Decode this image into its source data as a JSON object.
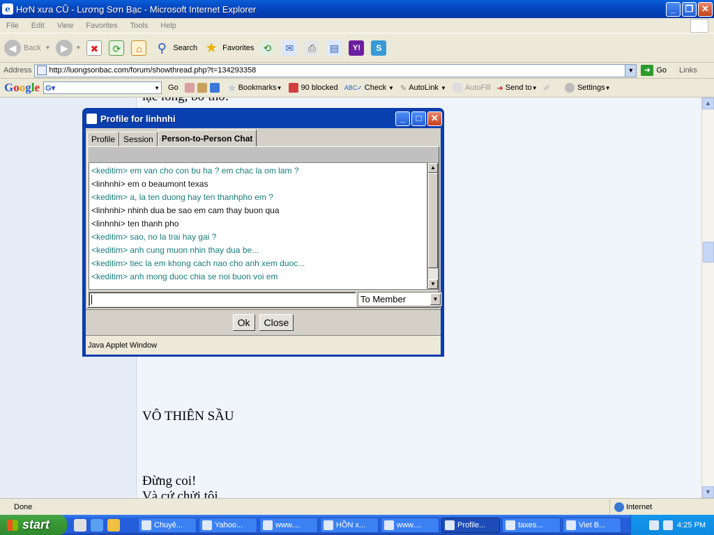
{
  "window": {
    "title": "HơN xưa CŨ - Lương Sơn Bạc - Microsoft Internet Explorer"
  },
  "menu": [
    "File",
    "Edit",
    "View",
    "Favorites",
    "Tools",
    "Help"
  ],
  "toolbar": {
    "back": "Back",
    "search": "Search",
    "favorites": "Favorites"
  },
  "address": {
    "label": "Address",
    "url": "http://luongsonbac.com/forum/showthread.php?t=134293358",
    "go": "Go",
    "links": "Links"
  },
  "googlebar": {
    "logo": "Google",
    "go": "Go",
    "bookmarks": "Bookmarks",
    "blocked": "90 blocked",
    "check": "Check",
    "autolink": "AutoLink",
    "autofill": "AutoFill",
    "sendto": "Send to",
    "settings": "Settings"
  },
  "page": {
    "top_text": "lạc lõng, bơ thờ.",
    "heading": "VÔ THIÊN SẦU",
    "line1": "Đừng coi!",
    "line2": "Và cứ chửi tôi,"
  },
  "dialog": {
    "title": "Profile for linhnhi",
    "tabs": [
      "Profile",
      "Session",
      "Person-to-Person Chat"
    ],
    "messages": [
      {
        "text": "<keditim> em van cho con bu ha ? em chac la om lam ?",
        "sender": "keditim"
      },
      {
        "text": "<linhnhi>  em o beaumont texas",
        "sender": "linhnhi"
      },
      {
        "text": "<keditim> a, la ten duong hay ten thanhpho em ?",
        "sender": "keditim"
      },
      {
        "text": "<linhnhi>  nhinh dua be sao em cam thay buon qua",
        "sender": "linhnhi"
      },
      {
        "text": "<linhnhi>  ten thanh pho",
        "sender": "linhnhi"
      },
      {
        "text": "<keditim> sao, no la trai hay gai ?",
        "sender": "keditim"
      },
      {
        "text": "<keditim> anh cung muon nhin thay dua be...",
        "sender": "keditim"
      },
      {
        "text": "<keditim> tiec la em khong cach nao cho anh xem duoc...",
        "sender": "keditim"
      },
      {
        "text": "<keditim> anh mong duoc chia se noi buon voi em",
        "sender": "keditim"
      }
    ],
    "input_value": "",
    "recipient": "To Member",
    "ok": "Ok",
    "close": "Close",
    "applet_label": "Java Applet Window",
    "colors": {
      "keditim": "#1a7a7a",
      "linhnhi": "#111111"
    }
  },
  "status": {
    "text": "Done",
    "zone": "Internet"
  },
  "taskbar": {
    "start": "start",
    "tasks": [
      "Chuyê...",
      "Yahoo...",
      "www....",
      "HỒN x...",
      "www....",
      "Profile...",
      "taxes...",
      "Viet B..."
    ],
    "active_index": 5,
    "clock": "4:25 PM"
  }
}
